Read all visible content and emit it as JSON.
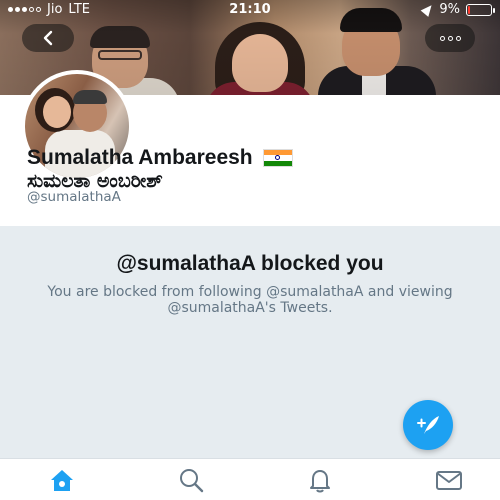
{
  "status_bar": {
    "carrier": "Jio",
    "network": "LTE",
    "time": "21:10",
    "battery_percent": "9%",
    "battery_level": 0.09,
    "battery_color": "#ff3b30"
  },
  "header": {
    "back_icon": "chevron-left-icon",
    "more_icon": "more-options-icon"
  },
  "profile": {
    "display_name": "Sumalatha Ambareesh",
    "flag_icon": "india-flag-icon",
    "display_name_kannada": "ಸುಮಲತಾ ಅಂಬರೀಶ್",
    "handle": "@sumalathaA"
  },
  "blocked": {
    "title": "@sumalathaA blocked you",
    "message": "You are blocked from following @sumalathaA and viewing @sumalathaA's Tweets."
  },
  "fab": {
    "icon": "compose-tweet-icon",
    "color": "#1da1f2"
  },
  "tab_bar": {
    "items": [
      {
        "icon": "home-icon",
        "active": true
      },
      {
        "icon": "search-icon",
        "active": false
      },
      {
        "icon": "notifications-bell-icon",
        "active": false
      },
      {
        "icon": "messages-envelope-icon",
        "active": false
      }
    ],
    "active_color": "#1da1f2",
    "inactive_color": "#657786"
  }
}
